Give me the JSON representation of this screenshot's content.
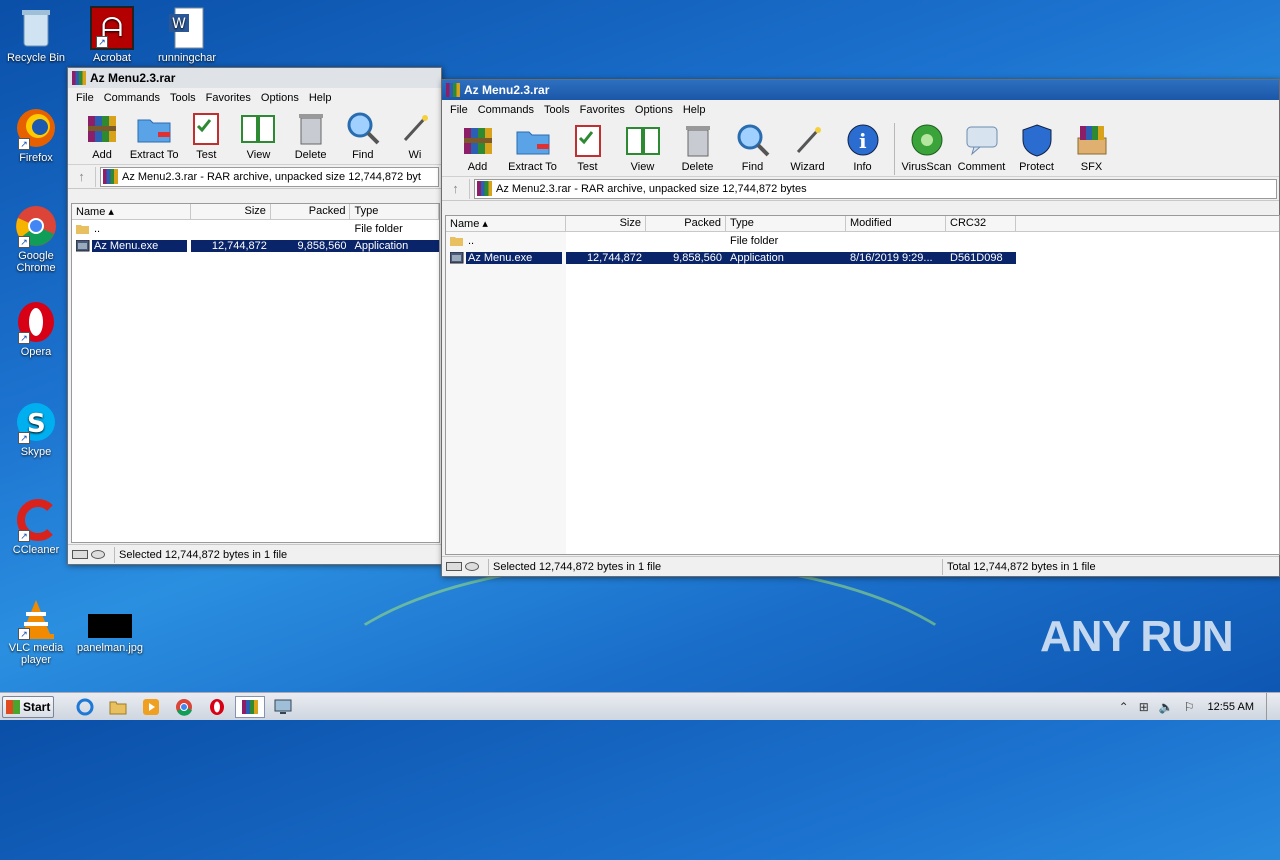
{
  "desktop": {
    "icons": [
      {
        "label": "Recycle Bin",
        "icon": "recycle-bin-icon"
      },
      {
        "label": "Acrobat",
        "icon": "acrobat-icon"
      },
      {
        "label": "runningchar",
        "icon": "word-document-icon"
      },
      {
        "label": "Firefox",
        "icon": "firefox-icon"
      },
      {
        "label": "Google Chrome",
        "icon": "chrome-icon"
      },
      {
        "label": "Opera",
        "icon": "opera-icon"
      },
      {
        "label": "Skype",
        "icon": "skype-icon"
      },
      {
        "label": "CCleaner",
        "icon": "ccleaner-icon"
      },
      {
        "label": "VLC media player",
        "icon": "vlc-icon"
      },
      {
        "label": "panelman.jpg",
        "icon": "image-file-icon"
      }
    ]
  },
  "win1": {
    "title": "Az Menu2.3.rar",
    "menu": [
      "File",
      "Commands",
      "Tools",
      "Favorites",
      "Options",
      "Help"
    ],
    "toolbar": [
      "Add",
      "Extract To",
      "Test",
      "View",
      "Delete",
      "Find",
      "Wi"
    ],
    "address": "Az Menu2.3.rar - RAR archive, unpacked size 12,744,872 byt",
    "columns": [
      "Name",
      "Size",
      "Packed",
      "Type"
    ],
    "rows": [
      {
        "name": "..",
        "size": "",
        "packed": "",
        "type": "File folder"
      },
      {
        "name": "Az Menu.exe",
        "size": "12,744,872",
        "packed": "9,858,560",
        "type": "Application"
      }
    ],
    "status": "Selected 12,744,872 bytes in 1 file"
  },
  "win2": {
    "title": "Az Menu2.3.rar",
    "menu": [
      "File",
      "Commands",
      "Tools",
      "Favorites",
      "Options",
      "Help"
    ],
    "toolbar": [
      "Add",
      "Extract To",
      "Test",
      "View",
      "Delete",
      "Find",
      "Wizard",
      "Info",
      "VirusScan",
      "Comment",
      "Protect",
      "SFX"
    ],
    "address": "Az Menu2.3.rar - RAR archive, unpacked size 12,744,872 bytes",
    "columns": [
      "Name",
      "Size",
      "Packed",
      "Type",
      "Modified",
      "CRC32"
    ],
    "rows": [
      {
        "name": "..",
        "size": "",
        "packed": "",
        "type": "File folder",
        "modified": "",
        "crc": ""
      },
      {
        "name": "Az Menu.exe",
        "size": "12,744,872",
        "packed": "9,858,560",
        "type": "Application",
        "modified": "8/16/2019 9:29...",
        "crc": "D561D098"
      }
    ],
    "status_left": "Selected 12,744,872 bytes in 1 file",
    "status_right": "Total 12,744,872 bytes in 1 file"
  },
  "taskbar": {
    "start": "Start",
    "clock": "12:55 AM"
  },
  "watermark": "ANY RUN"
}
